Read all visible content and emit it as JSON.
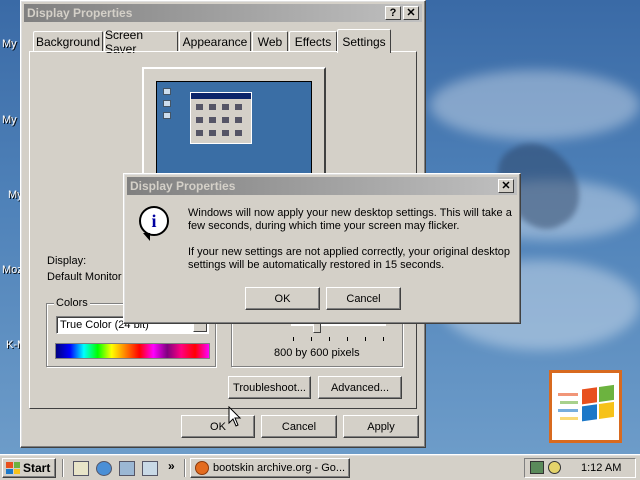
{
  "desktop": {
    "icon_labels": [
      "My",
      "My D",
      "My",
      "Moz",
      "K-M"
    ]
  },
  "main_window": {
    "title": "Display Properties",
    "help_button": "?",
    "close_button": "✕",
    "tabs": [
      {
        "label": "Background"
      },
      {
        "label": "Screen Saver"
      },
      {
        "label": "Appearance"
      },
      {
        "label": "Web"
      },
      {
        "label": "Effects"
      },
      {
        "label": "Settings",
        "active": true
      }
    ],
    "display_label": "Display:",
    "display_value": "Default Monitor o",
    "colors_label": "Colors",
    "colors_value": "True Color (24 bit)",
    "resolution_text": "800 by 600 pixels",
    "troubleshoot_button": "Troubleshoot...",
    "advanced_button": "Advanced...",
    "ok_button": "OK",
    "cancel_button": "Cancel",
    "apply_button": "Apply"
  },
  "dialog": {
    "title": "Display Properties",
    "close_button": "✕",
    "message_1": "Windows will now apply your new desktop settings. This will take a few seconds, during which time your screen may flicker.",
    "message_2": "If your new settings are not applied correctly, your original desktop settings will be automatically restored in 15 seconds.",
    "ok_button": "OK",
    "cancel_button": "Cancel"
  },
  "taskbar": {
    "start_label": "Start",
    "chevron": "»",
    "task_label": "bootskin archive.org - Go...",
    "clock": "1:12 AM"
  },
  "colors": {
    "title_active": "#0a246a",
    "face": "#d4d0c8",
    "desktop": "#3a6aa6"
  }
}
